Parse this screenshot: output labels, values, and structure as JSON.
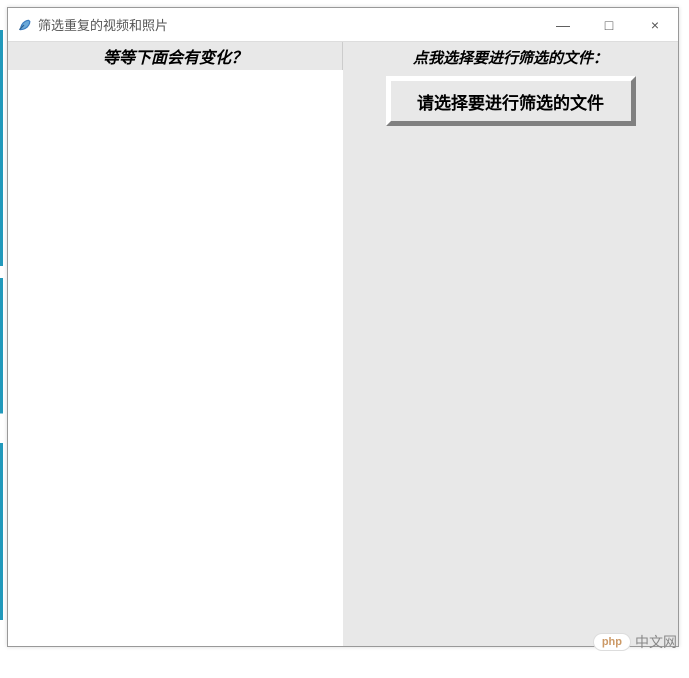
{
  "window": {
    "title": "筛选重复的视频和照片"
  },
  "left": {
    "header": "等等下面会有变化？"
  },
  "right": {
    "header": "点我选择要进行筛选的文件：",
    "button_label": "请选择要进行筛选的文件"
  },
  "watermark": {
    "badge": "php",
    "text": "中文网"
  },
  "titlebar_controls": {
    "minimize": "—",
    "maximize": "□",
    "close": "×"
  }
}
